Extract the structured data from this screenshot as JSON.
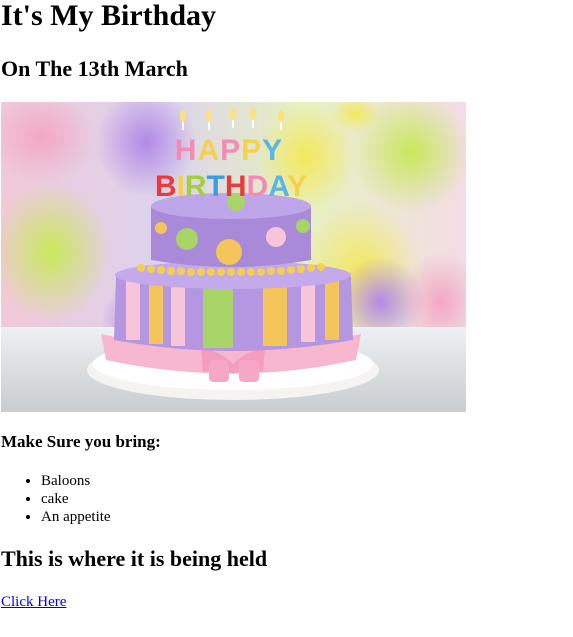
{
  "page": {
    "title": "It's My Birthday",
    "subtitle": "On The 13th March",
    "image": {
      "subject": "birthday cake with HAPPY BIRTHDAY candles and balloons",
      "candle_top": "HAPPY",
      "candle_bottom": "BIRTHDAY"
    },
    "bring_heading": "Make Sure you bring:",
    "bring_items": [
      "Baloons",
      "cake",
      "An appetite"
    ],
    "location_heading": "This is where it is being held",
    "link_text": "Click Here"
  },
  "colors": {
    "link": "#0000ee",
    "text": "#000000",
    "background": "#ffffff"
  }
}
